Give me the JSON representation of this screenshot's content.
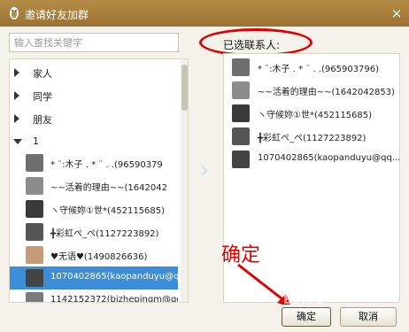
{
  "window": {
    "title": "邀请好友加群",
    "close_glyph": "×"
  },
  "search": {
    "placeholder": "输入查找关键字"
  },
  "groups": [
    {
      "label": "家人"
    },
    {
      "label": "同学"
    },
    {
      "label": "朋友"
    },
    {
      "label": "1"
    }
  ],
  "contacts": [
    {
      "name": "* ¨:木子 . * ¨ . .(96590379",
      "color": "#6f6f6f"
    },
    {
      "name": "~~活着的理由~~(1642042",
      "color": "#8c8c8c"
    },
    {
      "name": "ヽ守候妳①世*(452115685)",
      "color": "#3a3a3a"
    },
    {
      "name": "╋彩虹ぺ_ぺ(1127223892)",
      "color": "#555555"
    },
    {
      "name": "♥无语♥(1490826636)",
      "color": "#c79a7a"
    },
    {
      "name": "1070402865(kaopanduyu@qq.",
      "color": "#444444"
    },
    {
      "name": "1142152372(bizhepingm@qq.c",
      "color": "#7a7a7a"
    }
  ],
  "selected_label": "已选联系人:",
  "selected": [
    {
      "name": "* ¨:木子 . * ¨ . .(965903796)",
      "color": "#6f6f6f"
    },
    {
      "name": "~~活着的理由~~(1642042853)",
      "color": "#8c8c8c"
    },
    {
      "name": "ヽ守候妳①世*(452115685)",
      "color": "#3a3a3a"
    },
    {
      "name": "╋彩虹ぺ_ぺ(1127223892)",
      "color": "#555555"
    },
    {
      "name": "1070402865(kaopanduyu@qq....",
      "color": "#444444"
    }
  ],
  "annotation": "确定",
  "watermark": "Baidu",
  "buttons": {
    "ok": "确定",
    "cancel": "取消"
  }
}
